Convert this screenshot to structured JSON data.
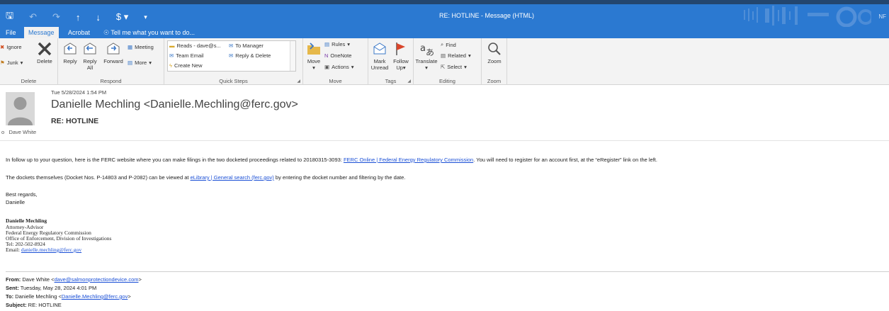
{
  "window": {
    "title": "RE: HOTLINE  -  Message (HTML)",
    "corner_text": "NF"
  },
  "tabs": [
    {
      "label": "File"
    },
    {
      "label": "Message"
    },
    {
      "label": "Acrobat"
    }
  ],
  "tell_me": "Tell me what you want to do...",
  "ribbon": {
    "delete_group": {
      "name": "Delete",
      "ignore": "Ignore",
      "junk": "Junk",
      "delete": "Delete"
    },
    "respond_group": {
      "name": "Respond",
      "reply": "Reply",
      "reply_all": "Reply All",
      "forward": "Forward",
      "meeting": "Meeting",
      "more": "More"
    },
    "quick_steps": {
      "name": "Quick Steps",
      "items": [
        "Reads - dave@s...",
        "To Manager",
        "Team Email",
        "Reply & Delete",
        "Create New"
      ]
    },
    "move_group": {
      "name": "Move",
      "move": "Move",
      "rules": "Rules",
      "onenote": "OneNote",
      "actions": "Actions"
    },
    "tags_group": {
      "name": "Tags",
      "mark_unread": "Mark Unread",
      "follow_up": "Follow Up"
    },
    "editing_group": {
      "name": "Editing",
      "translate": "Translate",
      "find": "Find",
      "related": "Related",
      "select": "Select"
    },
    "zoom_group": {
      "name": "Zoom",
      "zoom": "Zoom"
    }
  },
  "message": {
    "sent": "Tue 5/28/2024 1:54 PM",
    "sender": "Danielle Mechling <Danielle.Mechling@ferc.gov>",
    "subject": "RE: HOTLINE",
    "recipient_prefix": "o",
    "recipient": "Dave White"
  },
  "body": {
    "p1_text": "In follow up to your question, here is the FERC website where you can make filings in the two docketed proceedings related to 20180315-3093:  ",
    "p1_link": "FERC Online | Federal Energy Regulatory Commission",
    "p1_after": ".  You will need to register for an account first, at the “eRegister” link on the left.",
    "p2_text": "The dockets themselves (Docket Nos. P-14803 and P-2082) can be viewed at ",
    "p2_link": "eLibrary | General search (ferc.gov)",
    "p2_after": " by entering the docket number and filtering by the date.",
    "regards": "Best regards,",
    "name_short": "Danielle"
  },
  "signature": {
    "name": "Danielle Mechling",
    "title": "Attorney-Advisor",
    "org": "Federal Energy Regulatory Commission",
    "office": "Office of Enforcement, Division of Investigations",
    "tel": "Tel: 202-502-8924",
    "email_label": "Email: ",
    "email": "danielle.mechling@ferc.gov"
  },
  "forwarded": {
    "from_label": "From:",
    "from_name": " Dave White <",
    "from_email": "dave@salmonprotectiondevice.com",
    "from_end": ">",
    "sent_label": "Sent:",
    "sent_value": " Tuesday, May 28, 2024 4:01 PM",
    "to_label": "To:",
    "to_name": " Danielle Mechling <",
    "to_email": "Danielle.Mechling@ferc.gov",
    "to_end": ">",
    "subject_label": "Subject:",
    "subject_value": " RE: HOTLINE"
  },
  "colors": {
    "titlebar": "#2b79d1",
    "link": "#1a4fd6",
    "ribbon": "#f3f3f3"
  }
}
